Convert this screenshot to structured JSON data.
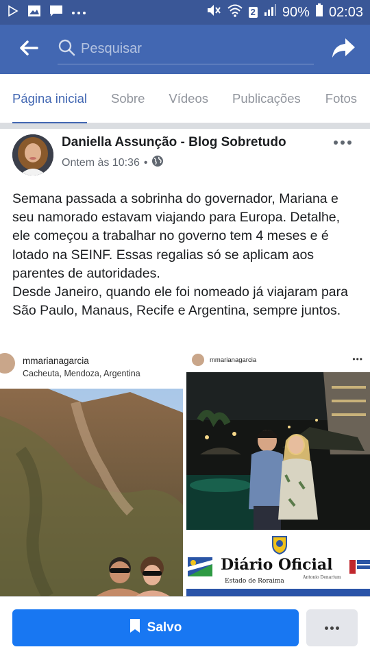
{
  "status_bar": {
    "battery_percent": "90%",
    "time": "02:03",
    "sim_slot": "2",
    "icons": [
      "play-store-icon",
      "gallery-icon",
      "message-icon",
      "more-notifications-icon",
      "mute-icon",
      "wifi-icon",
      "signal-icon",
      "battery-icon"
    ]
  },
  "header": {
    "search_placeholder": "Pesquisar",
    "colors": {
      "header_bg": "#4267b2",
      "status_bg": "#3a5797"
    }
  },
  "tabs": [
    {
      "label": "Página inicial",
      "active": true
    },
    {
      "label": "Sobre",
      "active": false
    },
    {
      "label": "Vídeos",
      "active": false
    },
    {
      "label": "Publicações",
      "active": false
    },
    {
      "label": "Fotos",
      "active": false
    }
  ],
  "post": {
    "author": "Daniella Assunção - Blog Sobretudo",
    "timestamp": "Ontem às 10:36",
    "separator": "•",
    "audience_icon": "globe-icon",
    "text_paragraphs": [
      "Semana passada a sobrinha do governador, Mariana e seu namorado estavam viajando para Europa. Detalhe, ele começou a trabalhar no governo tem 4 meses e é lotado na SEINF. Essas regalias só se aplicam aos parentes de autoridades.",
      "Desde Janeiro, quando ele foi nomeado já viajaram para São Paulo, Manaus, Recife e Argentina, sempre juntos."
    ]
  },
  "images": {
    "left": {
      "username": "mmarianagarcia",
      "location": "Cacheuta, Mendoza, Argentina"
    },
    "right": {
      "username": "mmarianagarcia",
      "more": "•••",
      "newspaper_title": "Diário Oficial",
      "newspaper_subtitle": "Estado de Roraima",
      "newspaper_signature": "Antonio Denarium"
    }
  },
  "bottom_bar": {
    "saved_label": "Salvo",
    "primary_color": "#1877f2"
  }
}
